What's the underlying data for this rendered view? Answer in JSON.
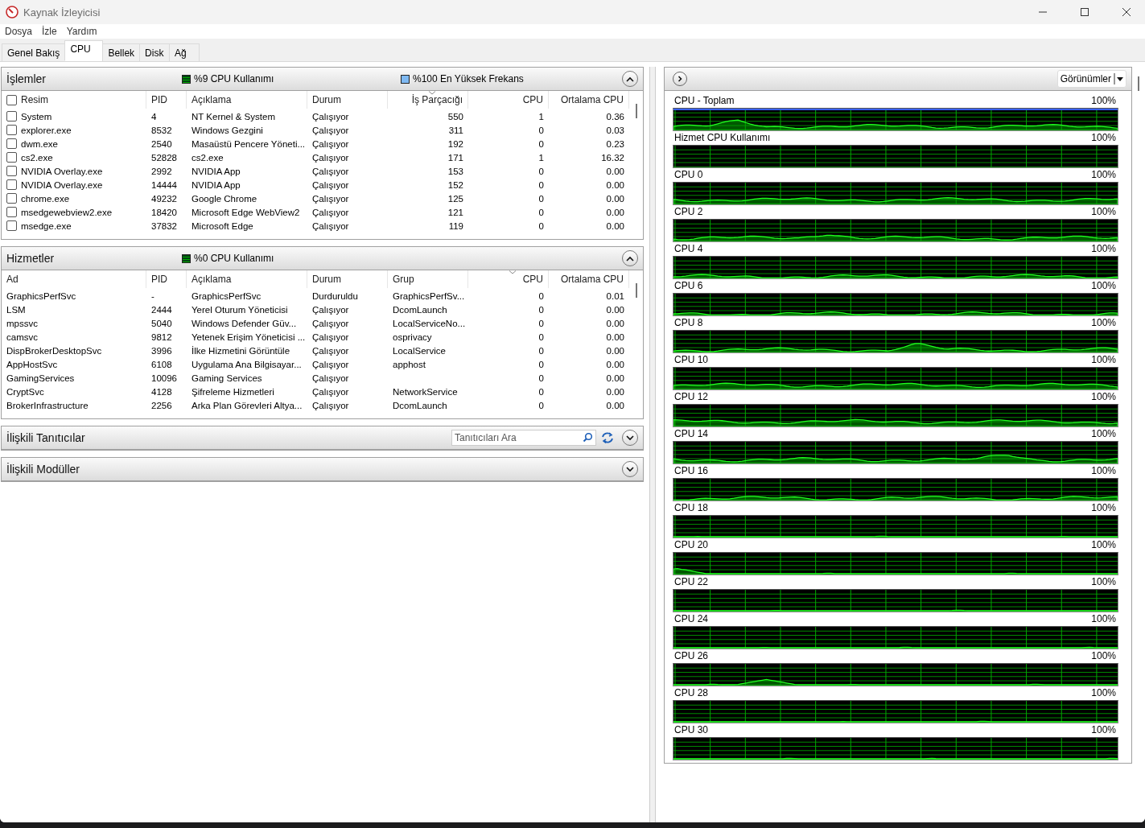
{
  "window": {
    "title": "Kaynak İzleyicisi"
  },
  "menu": [
    "Dosya",
    "İzle",
    "Yardım"
  ],
  "tabs": [
    {
      "label": "Genel Bakış",
      "selected": false
    },
    {
      "label": "CPU",
      "selected": true
    },
    {
      "label": "Bellek",
      "selected": false
    },
    {
      "label": "Disk",
      "selected": false
    },
    {
      "label": "Ağ",
      "selected": false
    }
  ],
  "processes": {
    "title": "İşlemler",
    "expanded": true,
    "legends": [
      {
        "kind": "usage",
        "label": "%9 CPU Kullanımı"
      },
      {
        "kind": "frequency",
        "label": "%100 En Yüksek Frekans"
      }
    ],
    "header_checked": false,
    "columns": [
      {
        "label": "Resim",
        "sorted": false
      },
      {
        "label": "PID",
        "sorted": false
      },
      {
        "label": "Açıklama",
        "sorted": false
      },
      {
        "label": "Durum",
        "sorted": false
      },
      {
        "label": "İş Parçacığı",
        "sorted": true
      },
      {
        "label": "CPU",
        "sorted": false
      },
      {
        "label": "Ortalama CPU",
        "sorted": false
      }
    ],
    "rows": [
      {
        "checked": false,
        "cells": [
          "System",
          "4",
          "NT Kernel & System",
          "Çalışıyor",
          "550",
          "1",
          "0.36"
        ]
      },
      {
        "checked": false,
        "cells": [
          "explorer.exe",
          "8532",
          "Windows Gezgini",
          "Çalışıyor",
          "311",
          "0",
          "0.03"
        ]
      },
      {
        "checked": false,
        "cells": [
          "dwm.exe",
          "2540",
          "Masaüstü Pencere Yöneti...",
          "Çalışıyor",
          "192",
          "0",
          "0.23"
        ]
      },
      {
        "checked": false,
        "cells": [
          "cs2.exe",
          "52828",
          "cs2.exe",
          "Çalışıyor",
          "171",
          "1",
          "16.32"
        ]
      },
      {
        "checked": false,
        "cells": [
          "NVIDIA Overlay.exe",
          "2992",
          "NVIDIA App",
          "Çalışıyor",
          "153",
          "0",
          "0.00"
        ]
      },
      {
        "checked": false,
        "cells": [
          "NVIDIA Overlay.exe",
          "14444",
          "NVIDIA App",
          "Çalışıyor",
          "152",
          "0",
          "0.00"
        ]
      },
      {
        "checked": false,
        "cells": [
          "chrome.exe",
          "49232",
          "Google Chrome",
          "Çalışıyor",
          "125",
          "0",
          "0.00"
        ]
      },
      {
        "checked": false,
        "cells": [
          "msedgewebview2.exe",
          "18420",
          "Microsoft Edge WebView2",
          "Çalışıyor",
          "121",
          "0",
          "0.00"
        ]
      },
      {
        "checked": false,
        "cells": [
          "msedge.exe",
          "37832",
          "Microsoft Edge",
          "Çalışıyor",
          "119",
          "0",
          "0.00"
        ]
      }
    ]
  },
  "services": {
    "title": "Hizmetler",
    "expanded": true,
    "legends": [
      {
        "kind": "usage",
        "label": "%0 CPU Kullanımı"
      }
    ],
    "columns": [
      {
        "label": "Ad",
        "sorted": false
      },
      {
        "label": "PID",
        "sorted": false
      },
      {
        "label": "Açıklama",
        "sorted": false
      },
      {
        "label": "Durum",
        "sorted": false
      },
      {
        "label": "Grup",
        "sorted": false
      },
      {
        "label": "CPU",
        "sorted": true
      },
      {
        "label": "Ortalama CPU",
        "sorted": false
      }
    ],
    "rows": [
      {
        "cells": [
          "GraphicsPerfSvc",
          "-",
          "GraphicsPerfSvc",
          "Durduruldu",
          "GraphicsPerfSv...",
          "0",
          "0.01"
        ]
      },
      {
        "cells": [
          "LSM",
          "2444",
          "Yerel Oturum Yöneticisi",
          "Çalışıyor",
          "DcomLaunch",
          "0",
          "0.00"
        ]
      },
      {
        "cells": [
          "mpssvc",
          "5040",
          "Windows Defender Güv...",
          "Çalışıyor",
          "LocalServiceNo...",
          "0",
          "0.00"
        ]
      },
      {
        "cells": [
          "camsvc",
          "9812",
          "Yetenek Erişim Yöneticisi ...",
          "Çalışıyor",
          "osprivacy",
          "0",
          "0.00"
        ]
      },
      {
        "cells": [
          "DispBrokerDesktopSvc",
          "3996",
          "İlke Hizmetini Görüntüle",
          "Çalışıyor",
          "LocalService",
          "0",
          "0.00"
        ]
      },
      {
        "cells": [
          "AppHostSvc",
          "6108",
          "Uygulama Ana Bilgisayar...",
          "Çalışıyor",
          "apphost",
          "0",
          "0.00"
        ]
      },
      {
        "cells": [
          "GamingServices",
          "10096",
          "Gaming Services",
          "Çalışıyor",
          null,
          "0",
          "0.00"
        ]
      },
      {
        "cells": [
          "CryptSvc",
          "4128",
          "Şifreleme Hizmetleri",
          "Çalışıyor",
          "NetworkService",
          "0",
          "0.00"
        ]
      },
      {
        "cells": [
          "BrokerInfrastructure",
          "2256",
          "Arka Plan Görevleri Altya...",
          "Çalışıyor",
          "DcomLaunch",
          "0",
          "0.00"
        ]
      }
    ]
  },
  "handles": {
    "title": "İlişkili Tanıtıcılar",
    "expanded": false,
    "search": {
      "placeholder": "Tanıtıcıları Ara"
    }
  },
  "modules": {
    "title": "İlişkili Modüller",
    "expanded": false
  },
  "graphs": {
    "views_button": "Görünümler",
    "items": [
      {
        "label": "CPU - Toplam",
        "max": "100%",
        "kind": "total"
      },
      {
        "label": "Hizmet CPU Kullanımı",
        "max": "100%",
        "kind": "service"
      },
      {
        "label": "CPU 0",
        "max": "100%",
        "kind": "core"
      },
      {
        "label": "CPU 2",
        "max": "100%",
        "kind": "core"
      },
      {
        "label": "CPU 4",
        "max": "100%",
        "kind": "core"
      },
      {
        "label": "CPU 6",
        "max": "100%",
        "kind": "core"
      },
      {
        "label": "CPU 8",
        "max": "100%",
        "kind": "core"
      },
      {
        "label": "CPU 10",
        "max": "100%",
        "kind": "core"
      },
      {
        "label": "CPU 12",
        "max": "100%",
        "kind": "core"
      },
      {
        "label": "CPU 14",
        "max": "100%",
        "kind": "core"
      },
      {
        "label": "CPU 16",
        "max": "100%",
        "kind": "core"
      },
      {
        "label": "CPU 18",
        "max": "100%",
        "kind": "core"
      },
      {
        "label": "CPU 20",
        "max": "100%",
        "kind": "core"
      },
      {
        "label": "CPU 22",
        "max": "100%",
        "kind": "core"
      },
      {
        "label": "CPU 24",
        "max": "100%",
        "kind": "core"
      },
      {
        "label": "CPU 26",
        "max": "100%",
        "kind": "core"
      },
      {
        "label": "CPU 28",
        "max": "100%",
        "kind": "core"
      },
      {
        "label": "CPU 30",
        "max": "100%",
        "kind": "core"
      }
    ]
  }
}
